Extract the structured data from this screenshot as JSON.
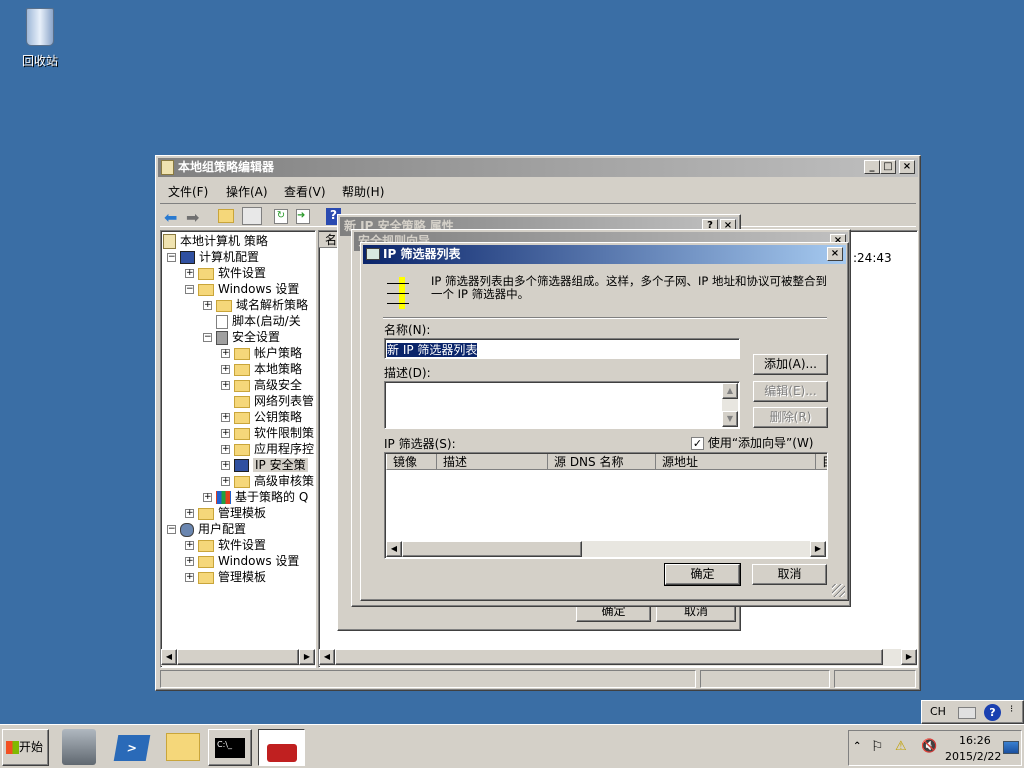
{
  "desktop": {
    "recycle_bin": "回收站"
  },
  "main_window": {
    "title": "本地组策略编辑器",
    "menu": [
      "文件(F)",
      "操作(A)",
      "查看(V)",
      "帮助(H)"
    ],
    "tree": [
      {
        "label": "本地计算机 策略",
        "level": 0,
        "icon": "policy-icon"
      },
      {
        "label": "计算机配置",
        "level": 1,
        "exp": "−",
        "icon": "computer-icon"
      },
      {
        "label": "软件设置",
        "level": 2,
        "exp": "+",
        "icon": "folder-icon"
      },
      {
        "label": "Windows 设置",
        "level": 2,
        "exp": "−",
        "icon": "folder-icon"
      },
      {
        "label": "域名解析策略",
        "level": 3,
        "exp": "+",
        "icon": "folder-icon"
      },
      {
        "label": "脚本(启动/关",
        "level": 3,
        "icon": "script-icon"
      },
      {
        "label": "安全设置",
        "level": 3,
        "exp": "−",
        "icon": "security-icon"
      },
      {
        "label": "帐户策略",
        "level": 4,
        "exp": "+",
        "icon": "locked-folder-icon"
      },
      {
        "label": "本地策略",
        "level": 4,
        "exp": "+",
        "icon": "locked-folder-icon"
      },
      {
        "label": "高级安全",
        "level": 4,
        "exp": "+",
        "icon": "folder-icon"
      },
      {
        "label": "网络列表管",
        "level": 4,
        "icon": "folder-icon"
      },
      {
        "label": "公钥策略",
        "level": 4,
        "exp": "+",
        "icon": "folder-icon"
      },
      {
        "label": "软件限制策",
        "level": 4,
        "exp": "+",
        "icon": "folder-icon"
      },
      {
        "label": "应用程序控",
        "level": 4,
        "exp": "+",
        "icon": "folder-icon"
      },
      {
        "label": "IP 安全策",
        "level": 4,
        "exp": "+",
        "icon": "ip-security-icon",
        "selected": true
      },
      {
        "label": "高级审核策",
        "level": 4,
        "exp": "+",
        "icon": "folder-icon"
      },
      {
        "label": "基于策略的 Q",
        "level": 3,
        "exp": "+",
        "icon": "chart-icon"
      },
      {
        "label": "管理模板",
        "level": 2,
        "exp": "+",
        "icon": "folder-icon"
      },
      {
        "label": "用户配置",
        "level": 1,
        "exp": "−",
        "icon": "user-icon"
      },
      {
        "label": "软件设置",
        "level": 2,
        "exp": "+",
        "icon": "folder-icon"
      },
      {
        "label": "Windows 设置",
        "level": 2,
        "exp": "+",
        "icon": "folder-icon"
      },
      {
        "label": "管理模板",
        "level": 2,
        "exp": "+",
        "icon": "folder-icon"
      }
    ],
    "list_header": "名",
    "list_time": ":24:43"
  },
  "properties_dialog": {
    "title": "新 IP 安全策略 属性",
    "ok": "确定",
    "cancel": "取消"
  },
  "wizard_dialog": {
    "title": "安全规则向导"
  },
  "filter_dialog": {
    "title": "IP 筛选器列表",
    "description": "IP 筛选器列表由多个筛选器组成。这样，多个子网、IP 地址和协议可被整合到一个 IP 筛选器中。",
    "name_label": "名称(N):",
    "name_value": "新 IP 筛选器列表",
    "desc_label": "描述(D):",
    "add": "添加(A)...",
    "edit": "编辑(E)...",
    "remove": "删除(R)",
    "filters_label": "IP 筛选器(S):",
    "wizard_checkbox": "使用“添加向导”(W)",
    "wizard_checked": true,
    "columns": [
      "镜像",
      "描述",
      "源 DNS 名称",
      "源地址",
      "目"
    ],
    "ok": "确定",
    "cancel": "取消"
  },
  "taskbar": {
    "start": "开始",
    "language": "CH",
    "time": "16:26",
    "date": "2015/2/22"
  }
}
